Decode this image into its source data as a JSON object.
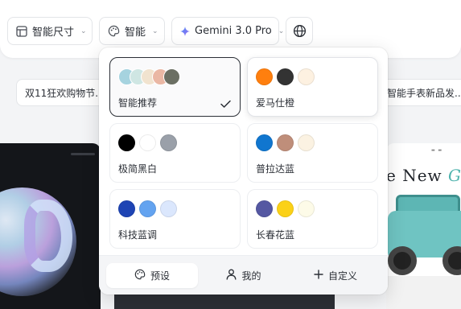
{
  "toolbar": {
    "size_label": "智能尺寸",
    "palette_label": "智能",
    "model_label": "Gemini 3.0 Pro"
  },
  "chips": [
    {
      "label": "双11狂欢购物节..."
    },
    {
      "label": "智能手表新品发..."
    }
  ],
  "background_cards": {
    "ad_headline_prefix": "e New ",
    "ad_headline_accent": "G"
  },
  "popover": {
    "themes": [
      {
        "name": "智能推荐",
        "selected": true,
        "colors": [
          "#a6d3df",
          "#cfe6e3",
          "#f1e3cf",
          "#eab7a4",
          "#6b6f63"
        ]
      },
      {
        "name": "爱马仕橙",
        "selected": false,
        "colors": [
          "#ff7f0e",
          "#333333",
          "#fdf1e1"
        ]
      },
      {
        "name": "极简黑白",
        "selected": false,
        "colors": [
          "#000000",
          "#ffffff",
          "#9aa0a9"
        ]
      },
      {
        "name": "普拉达蓝",
        "selected": false,
        "colors": [
          "#1076cf",
          "#bf8e7a",
          "#fbf2e2"
        ]
      },
      {
        "name": "科技蓝调",
        "selected": false,
        "colors": [
          "#1e44b4",
          "#63a3f0",
          "#dbe7fd"
        ]
      },
      {
        "name": "长春花蓝",
        "selected": false,
        "colors": [
          "#5558a2",
          "#fbd117",
          "#fdfbe8"
        ]
      }
    ],
    "tabs": {
      "preset": "预设",
      "mine": "我的",
      "custom": "自定义"
    }
  },
  "icons": {
    "size": "layout-icon",
    "palette": "palette-icon",
    "model": "sparkle-icon",
    "globe": "globe-icon",
    "check": "check-icon",
    "user": "user-icon",
    "plus": "plus-icon"
  }
}
